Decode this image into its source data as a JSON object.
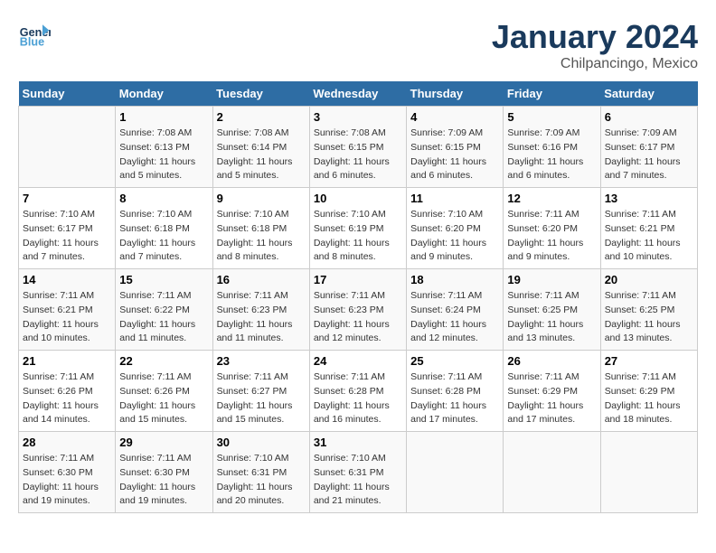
{
  "app": {
    "name": "GeneralBlue",
    "logo_icon": "🔵"
  },
  "calendar": {
    "title": "January 2024",
    "subtitle": "Chilpancingo, Mexico"
  },
  "headers": [
    "Sunday",
    "Monday",
    "Tuesday",
    "Wednesday",
    "Thursday",
    "Friday",
    "Saturday"
  ],
  "weeks": [
    [
      {
        "day": "",
        "info": ""
      },
      {
        "day": "1",
        "info": "Sunrise: 7:08 AM\nSunset: 6:13 PM\nDaylight: 11 hours\nand 5 minutes."
      },
      {
        "day": "2",
        "info": "Sunrise: 7:08 AM\nSunset: 6:14 PM\nDaylight: 11 hours\nand 5 minutes."
      },
      {
        "day": "3",
        "info": "Sunrise: 7:08 AM\nSunset: 6:15 PM\nDaylight: 11 hours\nand 6 minutes."
      },
      {
        "day": "4",
        "info": "Sunrise: 7:09 AM\nSunset: 6:15 PM\nDaylight: 11 hours\nand 6 minutes."
      },
      {
        "day": "5",
        "info": "Sunrise: 7:09 AM\nSunset: 6:16 PM\nDaylight: 11 hours\nand 6 minutes."
      },
      {
        "day": "6",
        "info": "Sunrise: 7:09 AM\nSunset: 6:17 PM\nDaylight: 11 hours\nand 7 minutes."
      }
    ],
    [
      {
        "day": "7",
        "info": "Sunrise: 7:10 AM\nSunset: 6:17 PM\nDaylight: 11 hours\nand 7 minutes."
      },
      {
        "day": "8",
        "info": "Sunrise: 7:10 AM\nSunset: 6:18 PM\nDaylight: 11 hours\nand 7 minutes."
      },
      {
        "day": "9",
        "info": "Sunrise: 7:10 AM\nSunset: 6:18 PM\nDaylight: 11 hours\nand 8 minutes."
      },
      {
        "day": "10",
        "info": "Sunrise: 7:10 AM\nSunset: 6:19 PM\nDaylight: 11 hours\nand 8 minutes."
      },
      {
        "day": "11",
        "info": "Sunrise: 7:10 AM\nSunset: 6:20 PM\nDaylight: 11 hours\nand 9 minutes."
      },
      {
        "day": "12",
        "info": "Sunrise: 7:11 AM\nSunset: 6:20 PM\nDaylight: 11 hours\nand 9 minutes."
      },
      {
        "day": "13",
        "info": "Sunrise: 7:11 AM\nSunset: 6:21 PM\nDaylight: 11 hours\nand 10 minutes."
      }
    ],
    [
      {
        "day": "14",
        "info": "Sunrise: 7:11 AM\nSunset: 6:21 PM\nDaylight: 11 hours\nand 10 minutes."
      },
      {
        "day": "15",
        "info": "Sunrise: 7:11 AM\nSunset: 6:22 PM\nDaylight: 11 hours\nand 11 minutes."
      },
      {
        "day": "16",
        "info": "Sunrise: 7:11 AM\nSunset: 6:23 PM\nDaylight: 11 hours\nand 11 minutes."
      },
      {
        "day": "17",
        "info": "Sunrise: 7:11 AM\nSunset: 6:23 PM\nDaylight: 11 hours\nand 12 minutes."
      },
      {
        "day": "18",
        "info": "Sunrise: 7:11 AM\nSunset: 6:24 PM\nDaylight: 11 hours\nand 12 minutes."
      },
      {
        "day": "19",
        "info": "Sunrise: 7:11 AM\nSunset: 6:25 PM\nDaylight: 11 hours\nand 13 minutes."
      },
      {
        "day": "20",
        "info": "Sunrise: 7:11 AM\nSunset: 6:25 PM\nDaylight: 11 hours\nand 13 minutes."
      }
    ],
    [
      {
        "day": "21",
        "info": "Sunrise: 7:11 AM\nSunset: 6:26 PM\nDaylight: 11 hours\nand 14 minutes."
      },
      {
        "day": "22",
        "info": "Sunrise: 7:11 AM\nSunset: 6:26 PM\nDaylight: 11 hours\nand 15 minutes."
      },
      {
        "day": "23",
        "info": "Sunrise: 7:11 AM\nSunset: 6:27 PM\nDaylight: 11 hours\nand 15 minutes."
      },
      {
        "day": "24",
        "info": "Sunrise: 7:11 AM\nSunset: 6:28 PM\nDaylight: 11 hours\nand 16 minutes."
      },
      {
        "day": "25",
        "info": "Sunrise: 7:11 AM\nSunset: 6:28 PM\nDaylight: 11 hours\nand 17 minutes."
      },
      {
        "day": "26",
        "info": "Sunrise: 7:11 AM\nSunset: 6:29 PM\nDaylight: 11 hours\nand 17 minutes."
      },
      {
        "day": "27",
        "info": "Sunrise: 7:11 AM\nSunset: 6:29 PM\nDaylight: 11 hours\nand 18 minutes."
      }
    ],
    [
      {
        "day": "28",
        "info": "Sunrise: 7:11 AM\nSunset: 6:30 PM\nDaylight: 11 hours\nand 19 minutes."
      },
      {
        "day": "29",
        "info": "Sunrise: 7:11 AM\nSunset: 6:30 PM\nDaylight: 11 hours\nand 19 minutes."
      },
      {
        "day": "30",
        "info": "Sunrise: 7:10 AM\nSunset: 6:31 PM\nDaylight: 11 hours\nand 20 minutes."
      },
      {
        "day": "31",
        "info": "Sunrise: 7:10 AM\nSunset: 6:31 PM\nDaylight: 11 hours\nand 21 minutes."
      },
      {
        "day": "",
        "info": ""
      },
      {
        "day": "",
        "info": ""
      },
      {
        "day": "",
        "info": ""
      }
    ]
  ]
}
